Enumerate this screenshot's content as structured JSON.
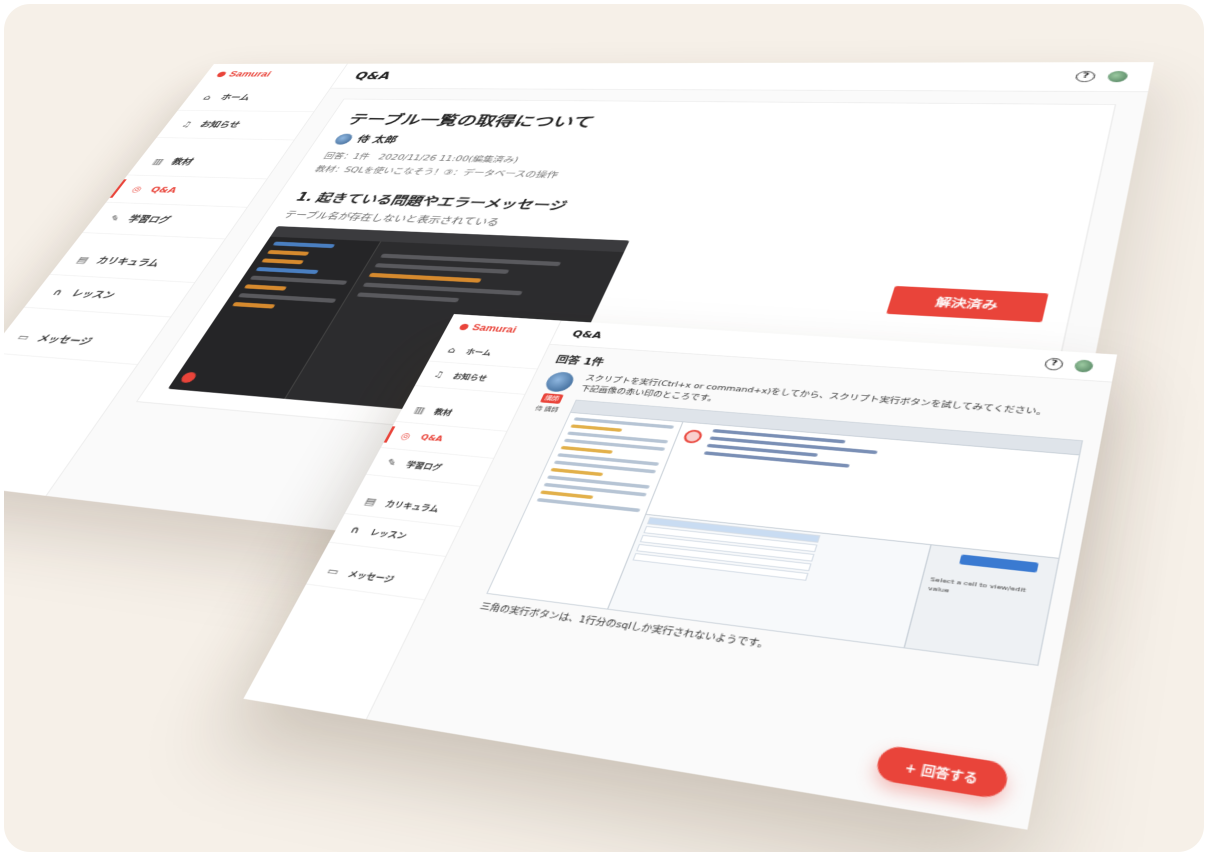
{
  "app": {
    "logo": "Samurai"
  },
  "sidebar": {
    "items": [
      {
        "label": "ホーム",
        "icon": "home-icon"
      },
      {
        "label": "お知らせ",
        "icon": "bell-icon"
      },
      {
        "label": "教材",
        "icon": "book-icon"
      },
      {
        "label": "Q&A",
        "icon": "question-icon",
        "active": true
      },
      {
        "label": "学習ログ",
        "icon": "pencil-icon"
      },
      {
        "label": "カリキュラム",
        "icon": "document-icon"
      },
      {
        "label": "レッスン",
        "icon": "headset-icon"
      },
      {
        "label": "メッセージ",
        "icon": "chat-icon"
      }
    ]
  },
  "header": {
    "title": "Q&A",
    "help_icon": "?"
  },
  "question": {
    "title": "テーブル一覧の取得について",
    "author": "侍 太郎",
    "meta": "回答：1件　2020/11/26 11:00(編集済み)",
    "material": "教材：SQLを使いこなそう！③：データベースの操作",
    "section1_title": "1. 起きている問題やエラーメッセージ",
    "section1_text": "テーブル名が存在しないと表示されている",
    "resolve_button": "解決済み"
  },
  "answer": {
    "count_label": "回答 1件",
    "badge": "講師",
    "responder": "侍 講師",
    "text1": "スクリプトを実行(Ctrl+x or command+x)をしてから、スクリプト実行ボタンを試してみてください。",
    "text2": "下記画像の赤い印のところです。",
    "note": "三角の実行ボタンは、1行分のsqlしか実行されないようです。",
    "panel_text": "Select a cell to view/edit value",
    "answer_button": "+ 回答する"
  },
  "colors": {
    "accent": "#e9443a",
    "background": "#f6f0e8"
  }
}
